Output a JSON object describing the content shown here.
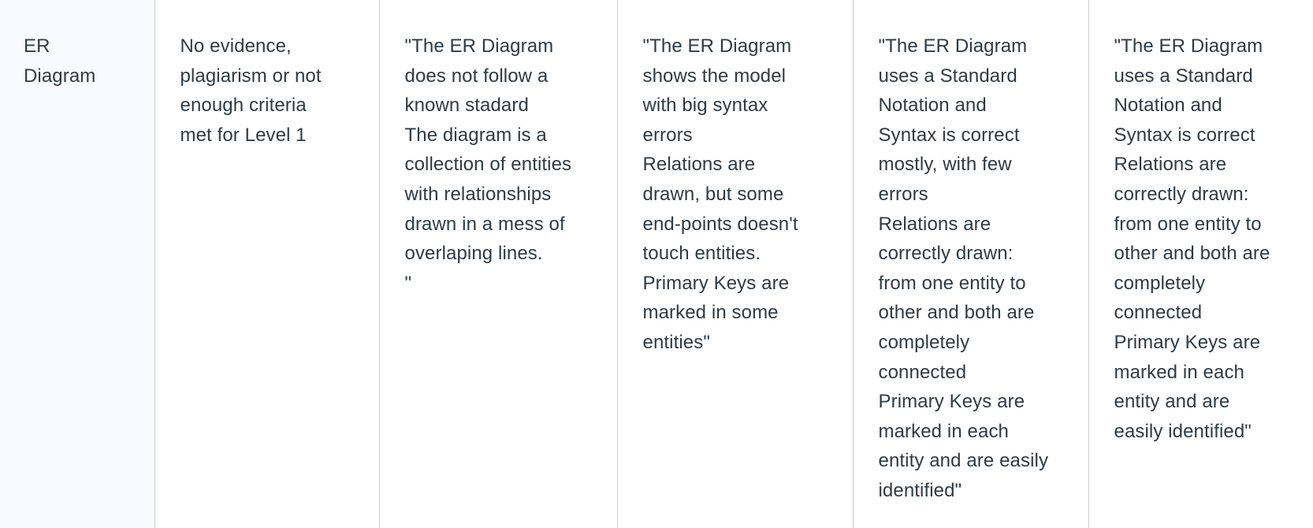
{
  "rubric_row": {
    "criterion": "ER\nDiagram",
    "ratings": [
      {
        "description": "No evidence,\nplagiarism or not\nenough criteria\nmet for Level 1"
      },
      {
        "description": "\"The ER Diagram\ndoes not follow a\nknown stadard\nThe diagram is a\ncollection of entities\nwith relationships\ndrawn in a mess of\noverlaping lines.\n\""
      },
      {
        "description": "\"The ER Diagram\nshows the model\nwith big syntax\nerrors\nRelations are\ndrawn, but some\nend-points doesn't\ntouch entities.\nPrimary Keys are\nmarked in some\nentities\""
      },
      {
        "description": "\"The ER Diagram\nuses a Standard\nNotation and\nSyntax is correct\nmostly, with few\nerrors\nRelations are\ncorrectly drawn:\nfrom one entity to\nother and both are\ncompletely\nconnected\nPrimary Keys are\nmarked in each\nentity and are easily\nidentified\""
      },
      {
        "description": "\"The ER Diagram\nuses a Standard\nNotation and\nSyntax is correct\nRelations are\ncorrectly drawn:\nfrom one entity to\nother and both are\ncompletely\nconnected\nPrimary Keys are\nmarked in each\nentity and are\neasily identified\""
      }
    ]
  },
  "colors": {
    "criterion_background": "#f8faff",
    "cell_background": "#ffffff",
    "border": "#c7cdd1",
    "text": "#2d3b45"
  }
}
